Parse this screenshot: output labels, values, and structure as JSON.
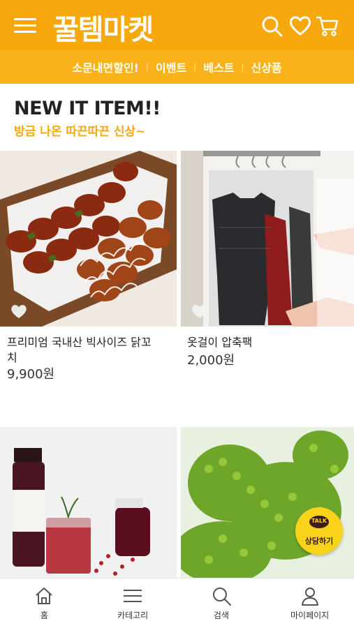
{
  "header": {
    "logo": "꿀템마켓",
    "accent": "#f7a80c"
  },
  "subnav": {
    "items": [
      "소문내면할인!",
      "이벤트",
      "베스트",
      "신상품"
    ]
  },
  "section": {
    "title": "NEW IT ITEM!!",
    "subtitle": "방금 나온 따끈따끈 신상~"
  },
  "products": [
    {
      "name_line1": "프리미엄 국내산 빅사이즈 닭꼬",
      "name_line2": "치",
      "price": "9,900원"
    },
    {
      "name_line1": "옷걸이 압축팩",
      "name_line2": "",
      "price": "2,000원"
    }
  ],
  "talk": {
    "badge": "TALK",
    "label": "상담하기"
  },
  "bottom_nav": {
    "items": [
      "홈",
      "카테고리",
      "검색",
      "마이페이지"
    ]
  }
}
